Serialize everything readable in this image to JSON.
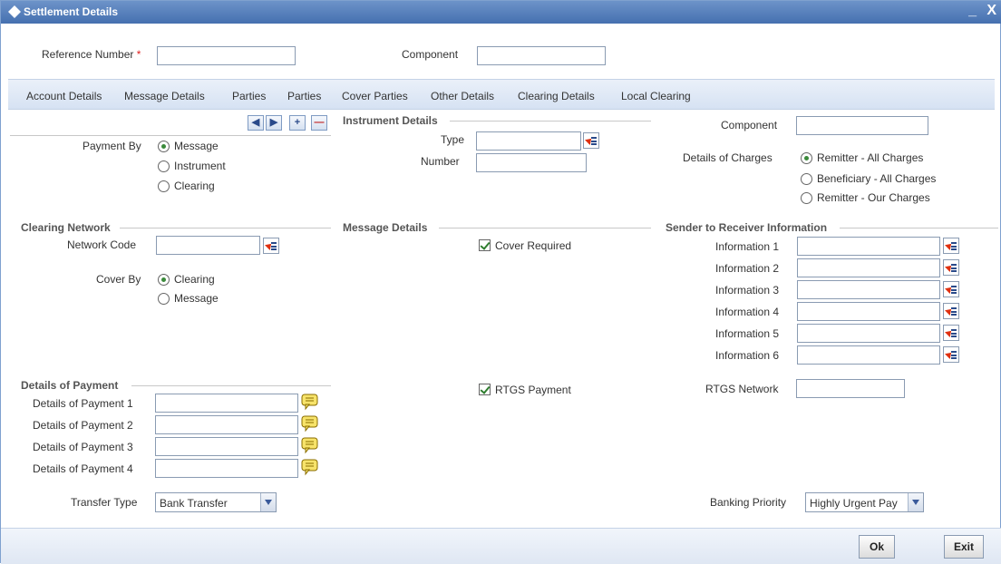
{
  "window": {
    "title": "Settlement Details",
    "minimize": "_",
    "close": "X"
  },
  "header": {
    "reference_number_label": "Reference Number",
    "required_mark": "*",
    "reference_number_value": "",
    "component_label": "Component",
    "component_value": ""
  },
  "tabs": [
    "Account Details",
    "Message Details",
    "Parties",
    "Parties",
    "Cover Parties",
    "Other Details",
    "Clearing Details",
    "Local Clearing"
  ],
  "navigation": {
    "prev": "◀",
    "next": "▶",
    "add": "+",
    "remove": "—"
  },
  "payment_by": {
    "label": "Payment By",
    "options": [
      "Message",
      "Instrument",
      "Clearing"
    ],
    "selected": "Message"
  },
  "instrument_details": {
    "title": "Instrument Details",
    "type_label": "Type",
    "type_value": "",
    "number_label": "Number",
    "number_value": ""
  },
  "charges": {
    "component_label": "Component",
    "component_value": "",
    "label": "Details of Charges",
    "options": [
      "Remitter - All Charges",
      "Beneficiary - All Charges",
      "Remitter - Our Charges"
    ],
    "selected": "Remitter - All Charges"
  },
  "clearing_network": {
    "title": "Clearing Network",
    "network_code_label": "Network Code",
    "network_code_value": "",
    "cover_by_label": "Cover By",
    "cover_by_options": [
      "Clearing",
      "Message"
    ],
    "cover_by_selected": "Clearing"
  },
  "message_details": {
    "title": "Message Details",
    "cover_required_label": "Cover Required",
    "cover_required_checked": true
  },
  "sender_to_receiver": {
    "title": "Sender to Receiver Information",
    "labels": [
      "Information 1",
      "Information 2",
      "Information 3",
      "Information 4",
      "Information 5",
      "Information 6"
    ]
  },
  "details_of_payment": {
    "title": "Details of Payment",
    "labels": [
      "Details of Payment 1",
      "Details of Payment 2",
      "Details of Payment 3",
      "Details of Payment 4"
    ]
  },
  "rtgs": {
    "payment_label": "RTGS Payment",
    "payment_checked": true,
    "network_label": "RTGS Network",
    "network_value": ""
  },
  "transfer": {
    "label": "Transfer Type",
    "value": "Bank Transfer"
  },
  "banking_priority": {
    "label": "Banking Priority",
    "value": "Highly Urgent Pay"
  },
  "footer": {
    "ok": "Ok",
    "exit": "Exit"
  },
  "colors": {
    "titlebar": "#4f7ab8",
    "tabbar": "#dbe6f4",
    "required": "#e02020"
  }
}
